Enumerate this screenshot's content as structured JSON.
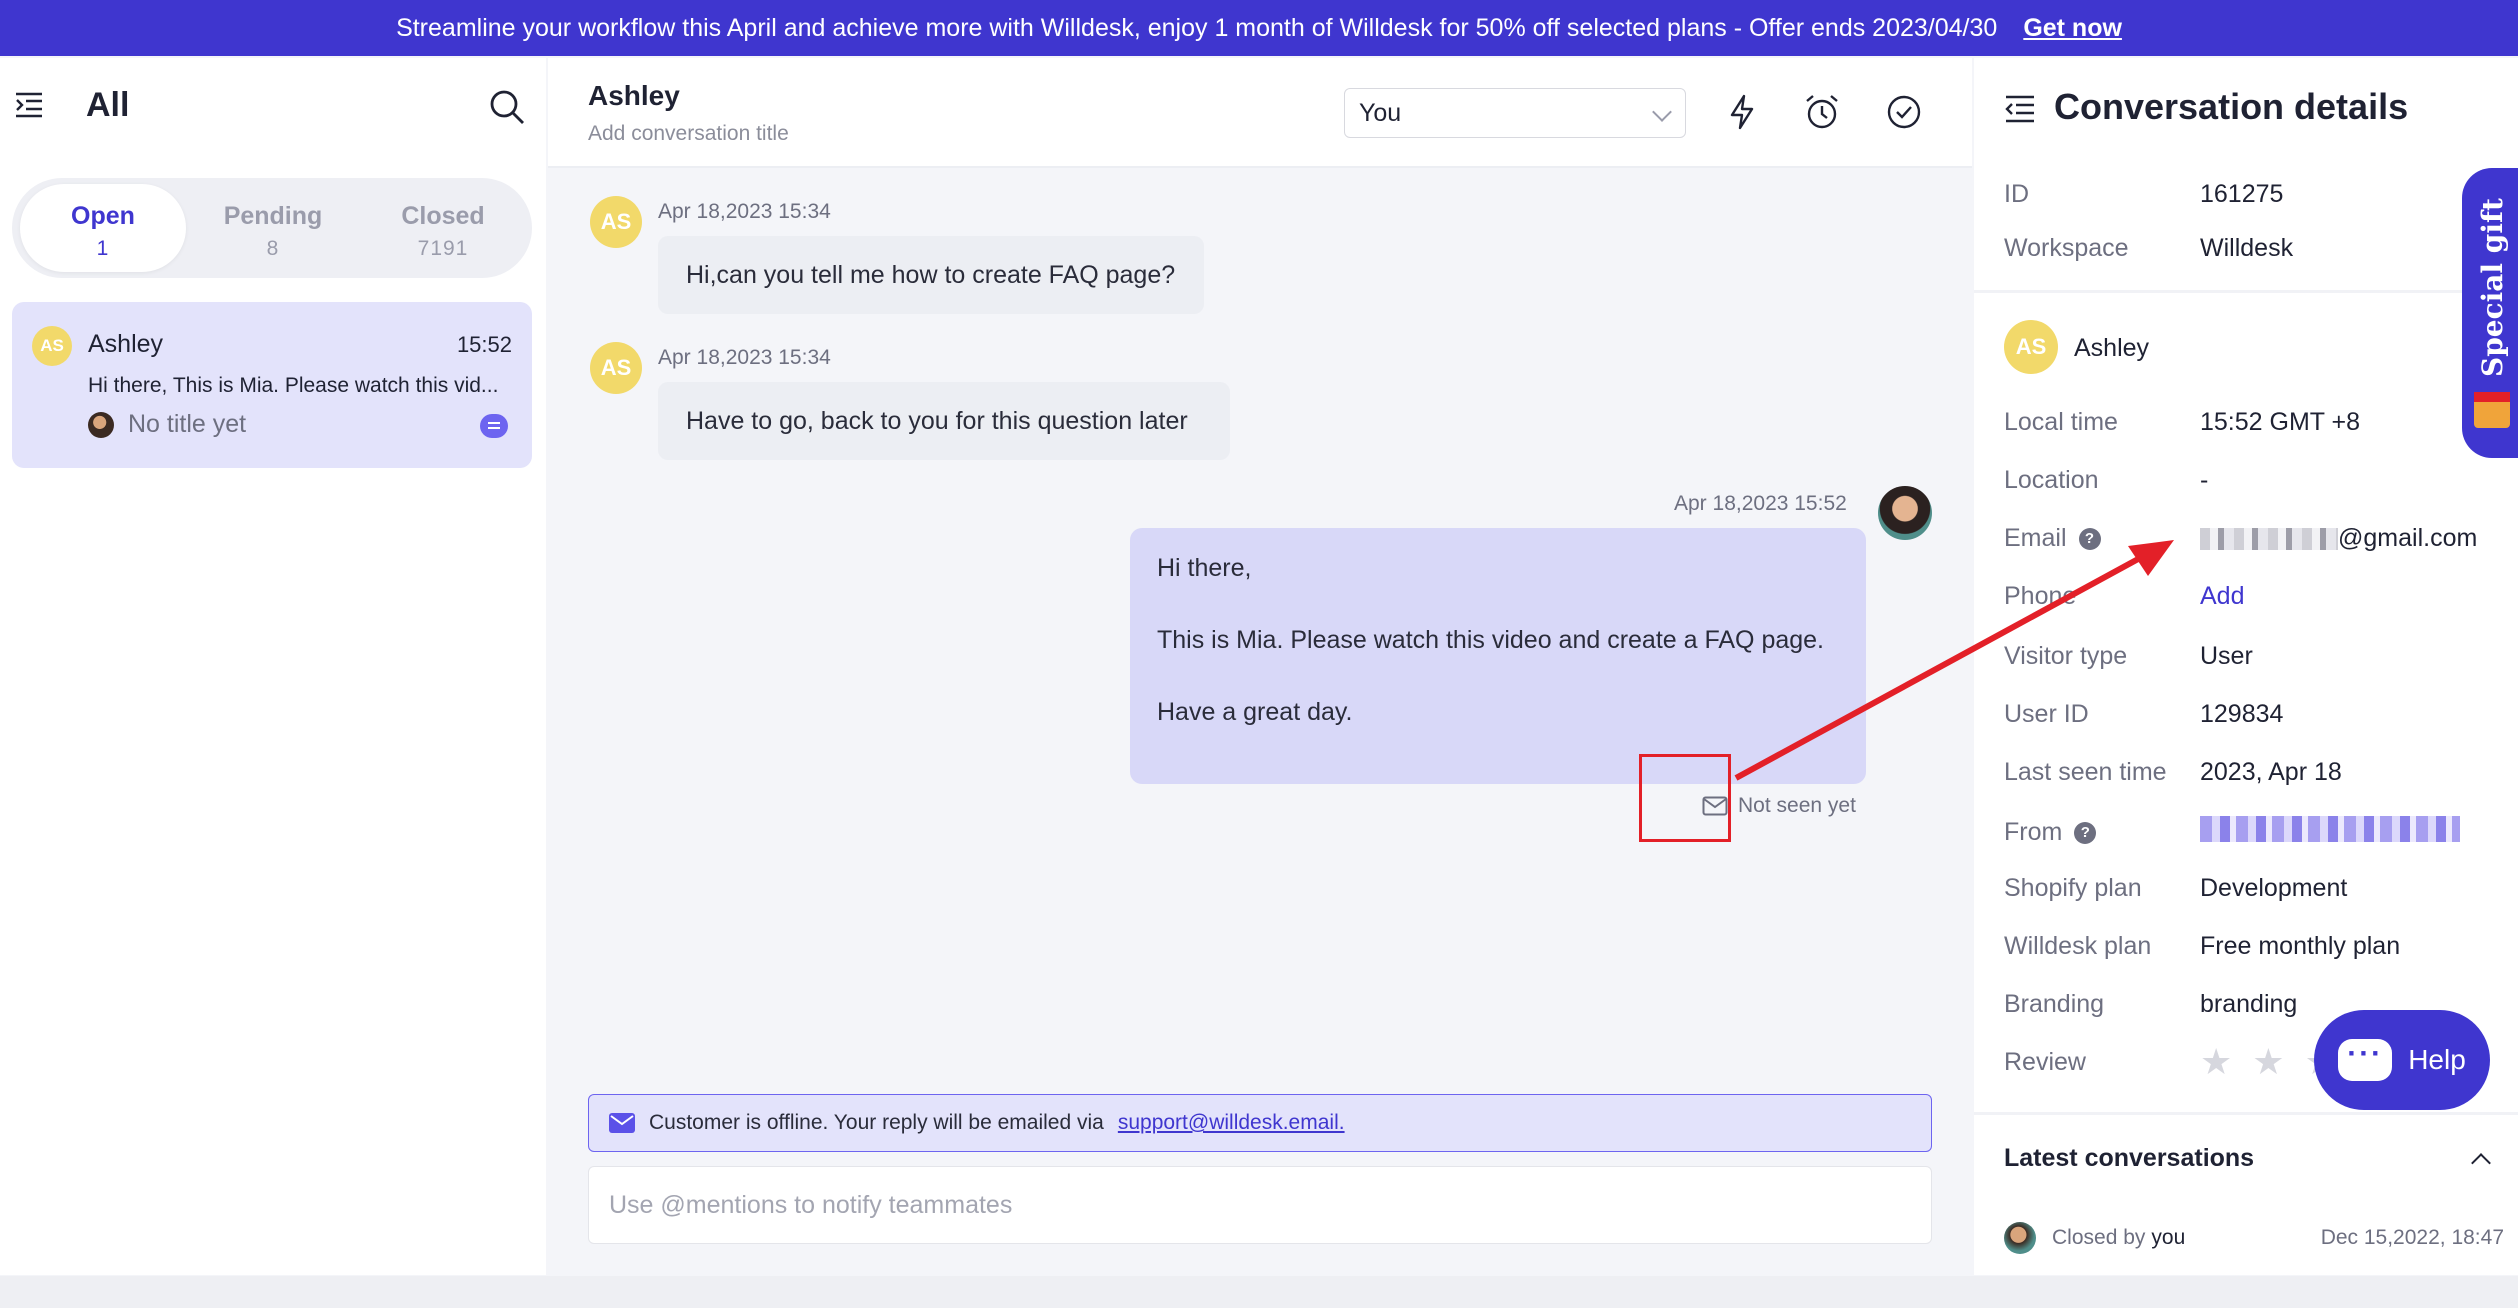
{
  "banner": {
    "text": "Streamline your workflow this April and achieve more with Willdesk, enjoy 1 month of Willdesk for 50% off selected plans - Offer ends 2023/04/30",
    "cta": "Get now"
  },
  "inbox": {
    "title": "All",
    "tabs": [
      {
        "label": "Open",
        "count": "1"
      },
      {
        "label": "Pending",
        "count": "8"
      },
      {
        "label": "Closed",
        "count": "7191"
      }
    ],
    "conversations": [
      {
        "initials": "AS",
        "name": "Ashley",
        "time": "15:52",
        "preview": "Hi there, This is Mia. Please watch this vid...",
        "title": "No title yet"
      }
    ]
  },
  "chat": {
    "contact_name": "Ashley",
    "title_placeholder": "Add conversation title",
    "assignee": "You",
    "messages": [
      {
        "initials": "AS",
        "timestamp": "Apr 18,2023 15:34",
        "text": "Hi,can you tell me how to create FAQ page?"
      },
      {
        "initials": "AS",
        "timestamp": "Apr 18,2023 15:34",
        "text": "Have to go, back to you for this question later"
      },
      {
        "timestamp": "Apr 18,2023 15:52",
        "lines": [
          "Hi there,",
          "This is Mia. Please watch this video and create a FAQ page.",
          "Have a great day."
        ],
        "status": "Not seen yet"
      }
    ],
    "offline_notice": "Customer is offline. Your reply will be emailed via",
    "offline_email": "support@willdesk.email.",
    "reply_placeholder": "Use @mentions to notify teammates"
  },
  "details": {
    "title": "Conversation details",
    "id_label": "ID",
    "id_value": "161275",
    "workspace_label": "Workspace",
    "workspace_value": "Willdesk",
    "user_initials": "AS",
    "user_name": "Ashley",
    "local_time_label": "Local time",
    "local_time_value": "15:52 GMT +8",
    "location_label": "Location",
    "location_value": "-",
    "email_label": "Email",
    "email_value": "@gmail.com",
    "phone_label": "Phone",
    "phone_value": "Add",
    "visitor_type_label": "Visitor type",
    "visitor_type_value": "User",
    "user_id_label": "User ID",
    "user_id_value": "129834",
    "last_seen_label": "Last seen time",
    "last_seen_value": "2023, Apr 18",
    "from_label": "From",
    "shopify_plan_label": "Shopify plan",
    "shopify_plan_value": "Development",
    "willdesk_plan_label": "Willdesk plan",
    "willdesk_plan_value": "Free monthly plan",
    "branding_label": "Branding",
    "branding_value": "branding",
    "review_label": "Review",
    "latest_title": "Latest conversations",
    "latest": [
      {
        "status": "Closed by",
        "by": "you",
        "date": "Dec 15,2022, 18:47"
      }
    ]
  },
  "special_gift": "Special gift",
  "help_label": "Help",
  "colors": {
    "accent": "#3f36cf",
    "annotation": "#e32028",
    "outgoing_bubble": "#d8d8f8"
  }
}
